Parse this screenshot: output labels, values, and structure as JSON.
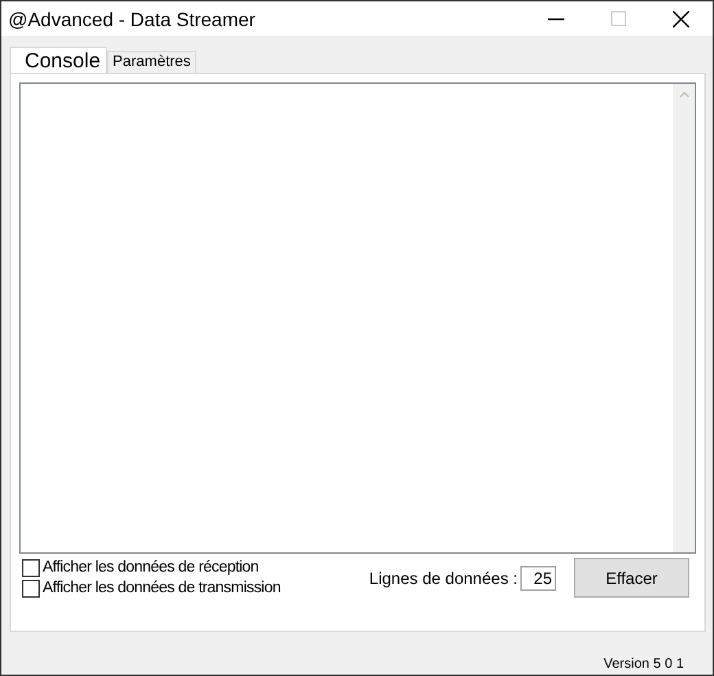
{
  "window": {
    "title": "@Advanced - Data Streamer"
  },
  "tabs": [
    {
      "label": "Console",
      "selected": true
    },
    {
      "label": "Paramètres",
      "selected": false
    }
  ],
  "console": {
    "options": [
      {
        "label": "Afficher les données de réception",
        "checked": false
      },
      {
        "label": "Afficher les données de transmission",
        "checked": false
      }
    ],
    "data_lines": {
      "label": "Lignes de données :",
      "value": "25"
    },
    "clear_button": "Effacer"
  },
  "status_bar": {
    "version": "Version 5 0 1"
  }
}
